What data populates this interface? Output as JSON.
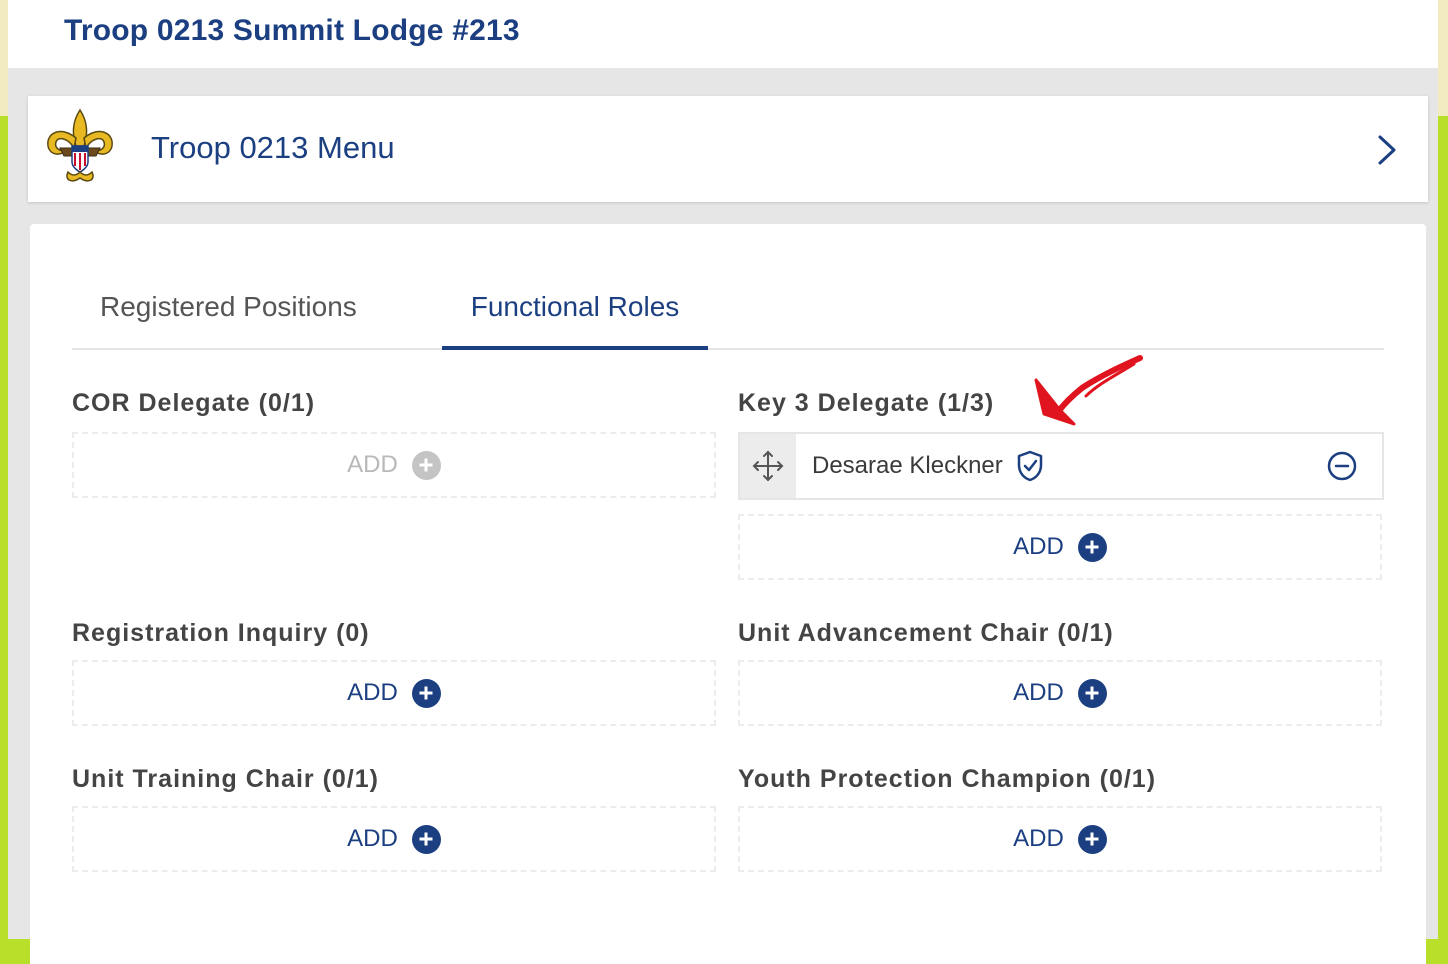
{
  "header": {
    "unit_title": "Troop 0213 Summit Lodge #213"
  },
  "menu": {
    "title": "Troop 0213 Menu",
    "logo_icon": "bsa-fleur-de-lis-logo",
    "chevron_icon": "chevron-right-icon"
  },
  "tabs": [
    {
      "label": "Registered Positions",
      "active": false
    },
    {
      "label": "Functional Roles",
      "active": true
    }
  ],
  "roles": {
    "cor_delegate": {
      "title": "COR Delegate (0/1)",
      "add_label": "ADD",
      "enabled": false
    },
    "key3_delegate": {
      "title": "Key 3 Delegate (1/3)",
      "add_label": "ADD",
      "enabled": true,
      "members": [
        {
          "name": "Desarae Kleckner",
          "badge_icon": "shield-check-icon"
        }
      ]
    },
    "registration_inquiry": {
      "title": "Registration Inquiry (0)",
      "add_label": "ADD",
      "enabled": true
    },
    "unit_advancement_chair": {
      "title": "Unit Advancement Chair (0/1)",
      "add_label": "ADD",
      "enabled": true
    },
    "unit_training_chair": {
      "title": "Unit Training Chair (0/1)",
      "add_label": "ADD",
      "enabled": true
    },
    "youth_protection_champion": {
      "title": "Youth Protection Champion (0/1)",
      "add_label": "ADD",
      "enabled": true
    }
  },
  "colors": {
    "brand_blue": "#1b3f80",
    "disabled_gray": "#c4c4c4",
    "annotation_red": "#e0141e",
    "outer_green": "#b8e02a"
  }
}
